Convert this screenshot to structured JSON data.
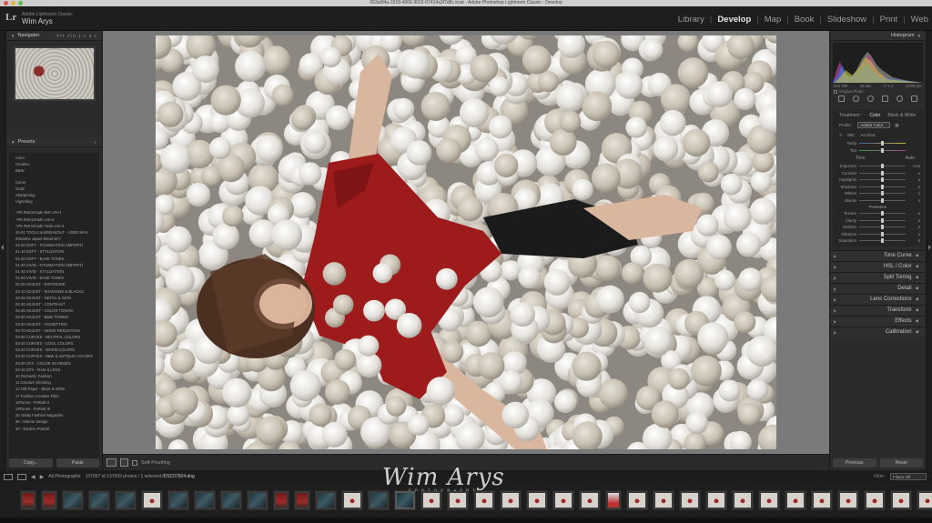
{
  "window": {
    "title": "653a9f4a-1018-4006-9015-07414a3f7d8c.lrcat - Adobe Photoshop Lightroom Classic - Develop"
  },
  "app": {
    "logo": "Lr",
    "product": "Adobe Lightroom Classic",
    "user": "Wim Arys"
  },
  "modules": [
    "Library",
    "Develop",
    "Map",
    "Book",
    "Slideshow",
    "Print",
    "Web"
  ],
  "active_module": "Develop",
  "left_panel": {
    "navigator": {
      "title": "Navigator",
      "zoom": "FIT  Fill  1:1  3:1"
    },
    "presets": {
      "title": "Presets",
      "groups_a": [
        "Color",
        "Creative",
        "B&W"
      ],
      "groups_b": [
        "Curve",
        "Grain",
        "Sharpening",
        "Vignetting"
      ],
      "user_presets": [
        "+P5 RetroGrade BW Lr5+4",
        "+P5 RetroGrade Lr5+4",
        "+P5 RetroGrade Tools Lr5+4",
        "20-01 TOOLS & BREAKOUT - USER MAX",
        "00Karine Japan Mood sin?",
        "01-00 SOFT - FOUNDATION (IMPORT)",
        "01-10 SOFT - STYLIZATION",
        "01-20 SOFT - BASE TONES",
        "01-30 VIVID - FOUNDATION (IMPORT)",
        "01-40 VIVID - STYLIZATION",
        "01-50 VIVID - BASE TONES",
        "02-00 ADJUST - EXPOSURE",
        "02-10 ADJUST - SHADOWS & BLACKS",
        "02-20 ADJUST - DETAIL & SKIN",
        "02-30 ADJUST - CONTRAST",
        "02-40 ADJUST - COLOR TONING",
        "02-50 ADJUST - B&W TONING",
        "02-60 ADJUST - VIGNETTING",
        "02-70 ADJUST - NOISE REDUCTION",
        "03-00 CURVES - NEUTRAL COLORS",
        "03-10 CURVES - COOL COLORS",
        "03-20 CURVES - WARM COLORS",
        "03-30 CURVES - B&W & ANTIQUE COLORS",
        "04-00 SFX - COLOR SCHEMES",
        "04-10 SFX - FILM & LENS",
        "10 Romantic Fashion",
        "11 Creative Shooting",
        "13 Old Paper - Black & White",
        "17 Fashion Creative Filter",
        "19Tunes - Portrait II",
        "19Tunes - Portrait III",
        "25 Vanity Fashion Magazine",
        "30 - Interior Design",
        "30 - Modern Portrait"
      ]
    },
    "copy_label": "Copy...",
    "paste_label": "Paste"
  },
  "toolbar": {
    "soft_proofing": "Soft Proofing"
  },
  "right_panel": {
    "histogram": {
      "title": "Histogram",
      "iso": "ISO 200",
      "focal": "35 mm",
      "aperture": "f / 1.4",
      "shutter": "1/200 sec",
      "original_photo": "Original Photo"
    },
    "basic": {
      "treatment_label": "Treatment :",
      "treatment_color": "Color",
      "treatment_bw": "Black & White",
      "profile_label": "Profile :",
      "profile_value": "Adobe Color",
      "wb_label": "WB :",
      "wb_value": "As Shot",
      "temp_label": "Temp",
      "tint_label": "Tint",
      "tone_label": "Tone",
      "auto_label": "Auto",
      "tone_rows": [
        {
          "label": "Exposure",
          "value": "0.00"
        },
        {
          "label": "Contrast",
          "value": "0"
        },
        {
          "label": "Highlights",
          "value": "0"
        },
        {
          "label": "Shadows",
          "value": "0"
        },
        {
          "label": "Whites",
          "value": "0"
        },
        {
          "label": "Blacks",
          "value": "0"
        }
      ],
      "presence_label": "Presence",
      "presence_rows": [
        {
          "label": "Texture",
          "value": "0"
        },
        {
          "label": "Clarity",
          "value": "0"
        },
        {
          "label": "Dehaze",
          "value": "0"
        },
        {
          "label": "Vibrance",
          "value": "0"
        },
        {
          "label": "Saturation",
          "value": "0"
        }
      ]
    },
    "sections": [
      "Tone Curve",
      "HSL / Color",
      "Split Toning",
      "Detail",
      "Lens Corrections",
      "Transform",
      "Effects",
      "Calibration"
    ],
    "previous_label": "Previous",
    "reset_label": "Reset"
  },
  "filmstrip_bar": {
    "source": "All Photographs",
    "count": "137007 of 137009 photos / 1 selected",
    "filename": "/DSC07504.dng",
    "filter_label": "Filter :",
    "filter_value": "Filters Off"
  },
  "watermark": {
    "signature": "Wim Arys",
    "sub": "PHOTOGRAPHY"
  },
  "colors": {
    "accent": "#e6e6e6",
    "panel": "#2b2b2b",
    "background": "#7a7a7a",
    "dress": "#9e1b1c"
  }
}
